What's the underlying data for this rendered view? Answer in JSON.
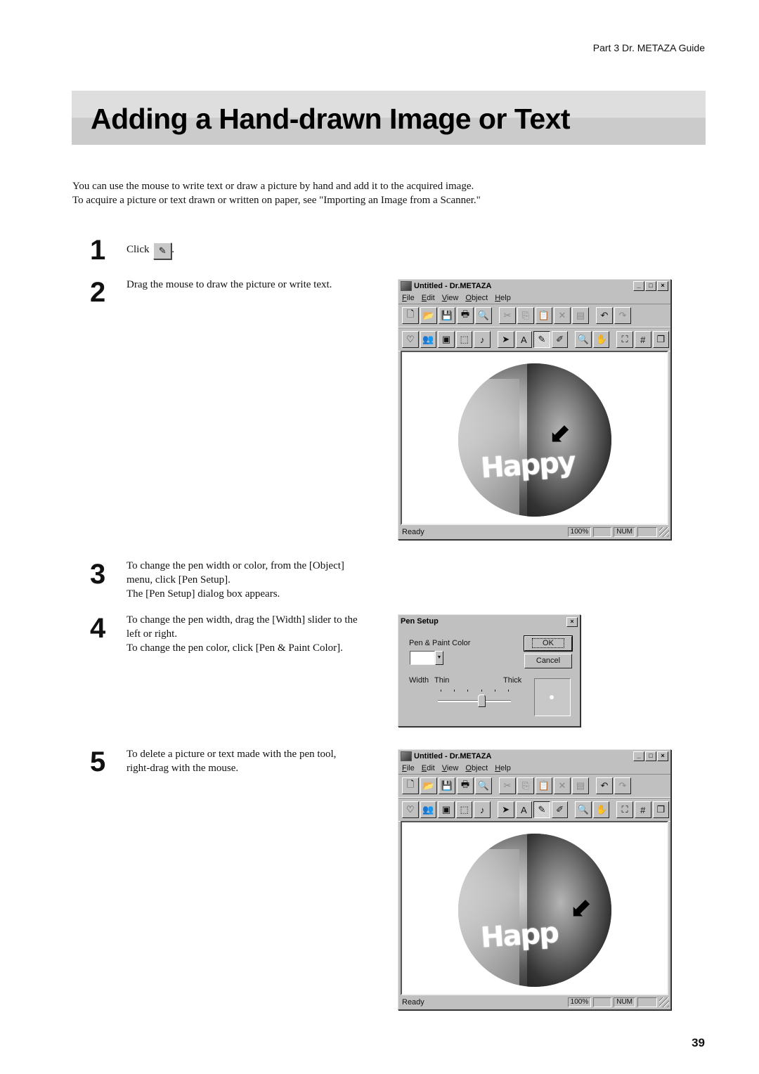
{
  "header": {
    "section": "Part 3  Dr. METAZA Guide"
  },
  "title": "Adding a Hand-drawn Image or Text",
  "intro": {
    "line1": "You can use the mouse to write text or draw a picture by hand and add it to the acquired image.",
    "line2": "To acquire a picture or text drawn or written on paper, see \"Importing an Image from a Scanner.\""
  },
  "steps": [
    {
      "num": "1",
      "text_before": "Click",
      "icon": "pen-tool-icon",
      "text_after": "."
    },
    {
      "num": "2",
      "text": "Drag the mouse to draw the picture or write text."
    },
    {
      "num": "3",
      "lines": [
        "To change the pen width or color, from the [Object]",
        "menu, click [Pen Setup].",
        "The [Pen Setup] dialog box appears."
      ]
    },
    {
      "num": "4",
      "lines": [
        "To change the pen width, drag the [Width] slider to the",
        "left or right.",
        "To change the pen color, click [Pen & Paint Color]."
      ]
    },
    {
      "num": "5",
      "lines": [
        "To delete a picture or text made with the pen tool,",
        "right-drag with the mouse."
      ]
    }
  ],
  "app_window": {
    "title": "Untitled - Dr.METAZA",
    "caption_buttons": [
      "_",
      "□",
      "×"
    ],
    "menu": [
      "File",
      "Edit",
      "View",
      "Object",
      "Help"
    ],
    "toolbar1": [
      {
        "icon": "new-file-icon",
        "glyph": "🗋",
        "enabled": true
      },
      {
        "icon": "open-folder-icon",
        "glyph": "📂",
        "enabled": true
      },
      {
        "icon": "save-icon",
        "glyph": "💾",
        "enabled": true
      },
      {
        "icon": "print-icon",
        "glyph": "🖶",
        "enabled": true
      },
      {
        "icon": "print-preview-icon",
        "glyph": "🔍",
        "enabled": true
      },
      {
        "sep": true
      },
      {
        "icon": "cut-icon",
        "glyph": "✂",
        "enabled": false
      },
      {
        "icon": "copy-icon",
        "glyph": "⎘",
        "enabled": false
      },
      {
        "icon": "paste-icon",
        "glyph": "📋",
        "enabled": true
      },
      {
        "icon": "delete-icon",
        "glyph": "✕",
        "enabled": false
      },
      {
        "icon": "properties-icon",
        "glyph": "▤",
        "enabled": false
      },
      {
        "sep": true
      },
      {
        "icon": "undo-icon",
        "glyph": "↶",
        "enabled": true
      },
      {
        "icon": "redo-icon",
        "glyph": "↷",
        "enabled": false
      }
    ],
    "toolbar2": [
      {
        "icon": "heart-frame-icon",
        "glyph": "♡"
      },
      {
        "icon": "people-icon",
        "glyph": "👥"
      },
      {
        "icon": "portrait-icon",
        "glyph": "▣"
      },
      {
        "icon": "dotted-frame-icon",
        "glyph": "⬚"
      },
      {
        "icon": "music-note-icon",
        "glyph": "♪"
      },
      {
        "sep": true
      },
      {
        "icon": "select-arrow-icon",
        "glyph": "➤"
      },
      {
        "icon": "text-tool-icon",
        "glyph": "A"
      },
      {
        "icon": "pen-tool-icon",
        "glyph": "✎",
        "active": true
      },
      {
        "icon": "eraser-icon",
        "glyph": "✐"
      },
      {
        "sep": true
      },
      {
        "icon": "zoom-icon",
        "glyph": "🔍"
      },
      {
        "icon": "hand-pan-icon",
        "glyph": "✋"
      },
      {
        "sep": true
      },
      {
        "icon": "fit-window-icon",
        "glyph": "⛶"
      },
      {
        "icon": "grid-icon",
        "glyph": "#"
      },
      {
        "icon": "layers-icon",
        "glyph": "❐"
      }
    ],
    "status": {
      "text": "Ready",
      "zoom": "100%",
      "num": "NUM"
    }
  },
  "canvas1": {
    "doodle": "Happy"
  },
  "canvas2": {
    "doodle": "Happ"
  },
  "pen_dialog": {
    "title": "Pen Setup",
    "color_label": "Pen & Paint Color",
    "color_value": "#ffffff",
    "ok": "OK",
    "cancel": "Cancel",
    "width_label": "Width",
    "thin_label": "Thin",
    "thick_label": "Thick",
    "width_ticks": 6,
    "width_position": 4
  },
  "page_number": "39"
}
